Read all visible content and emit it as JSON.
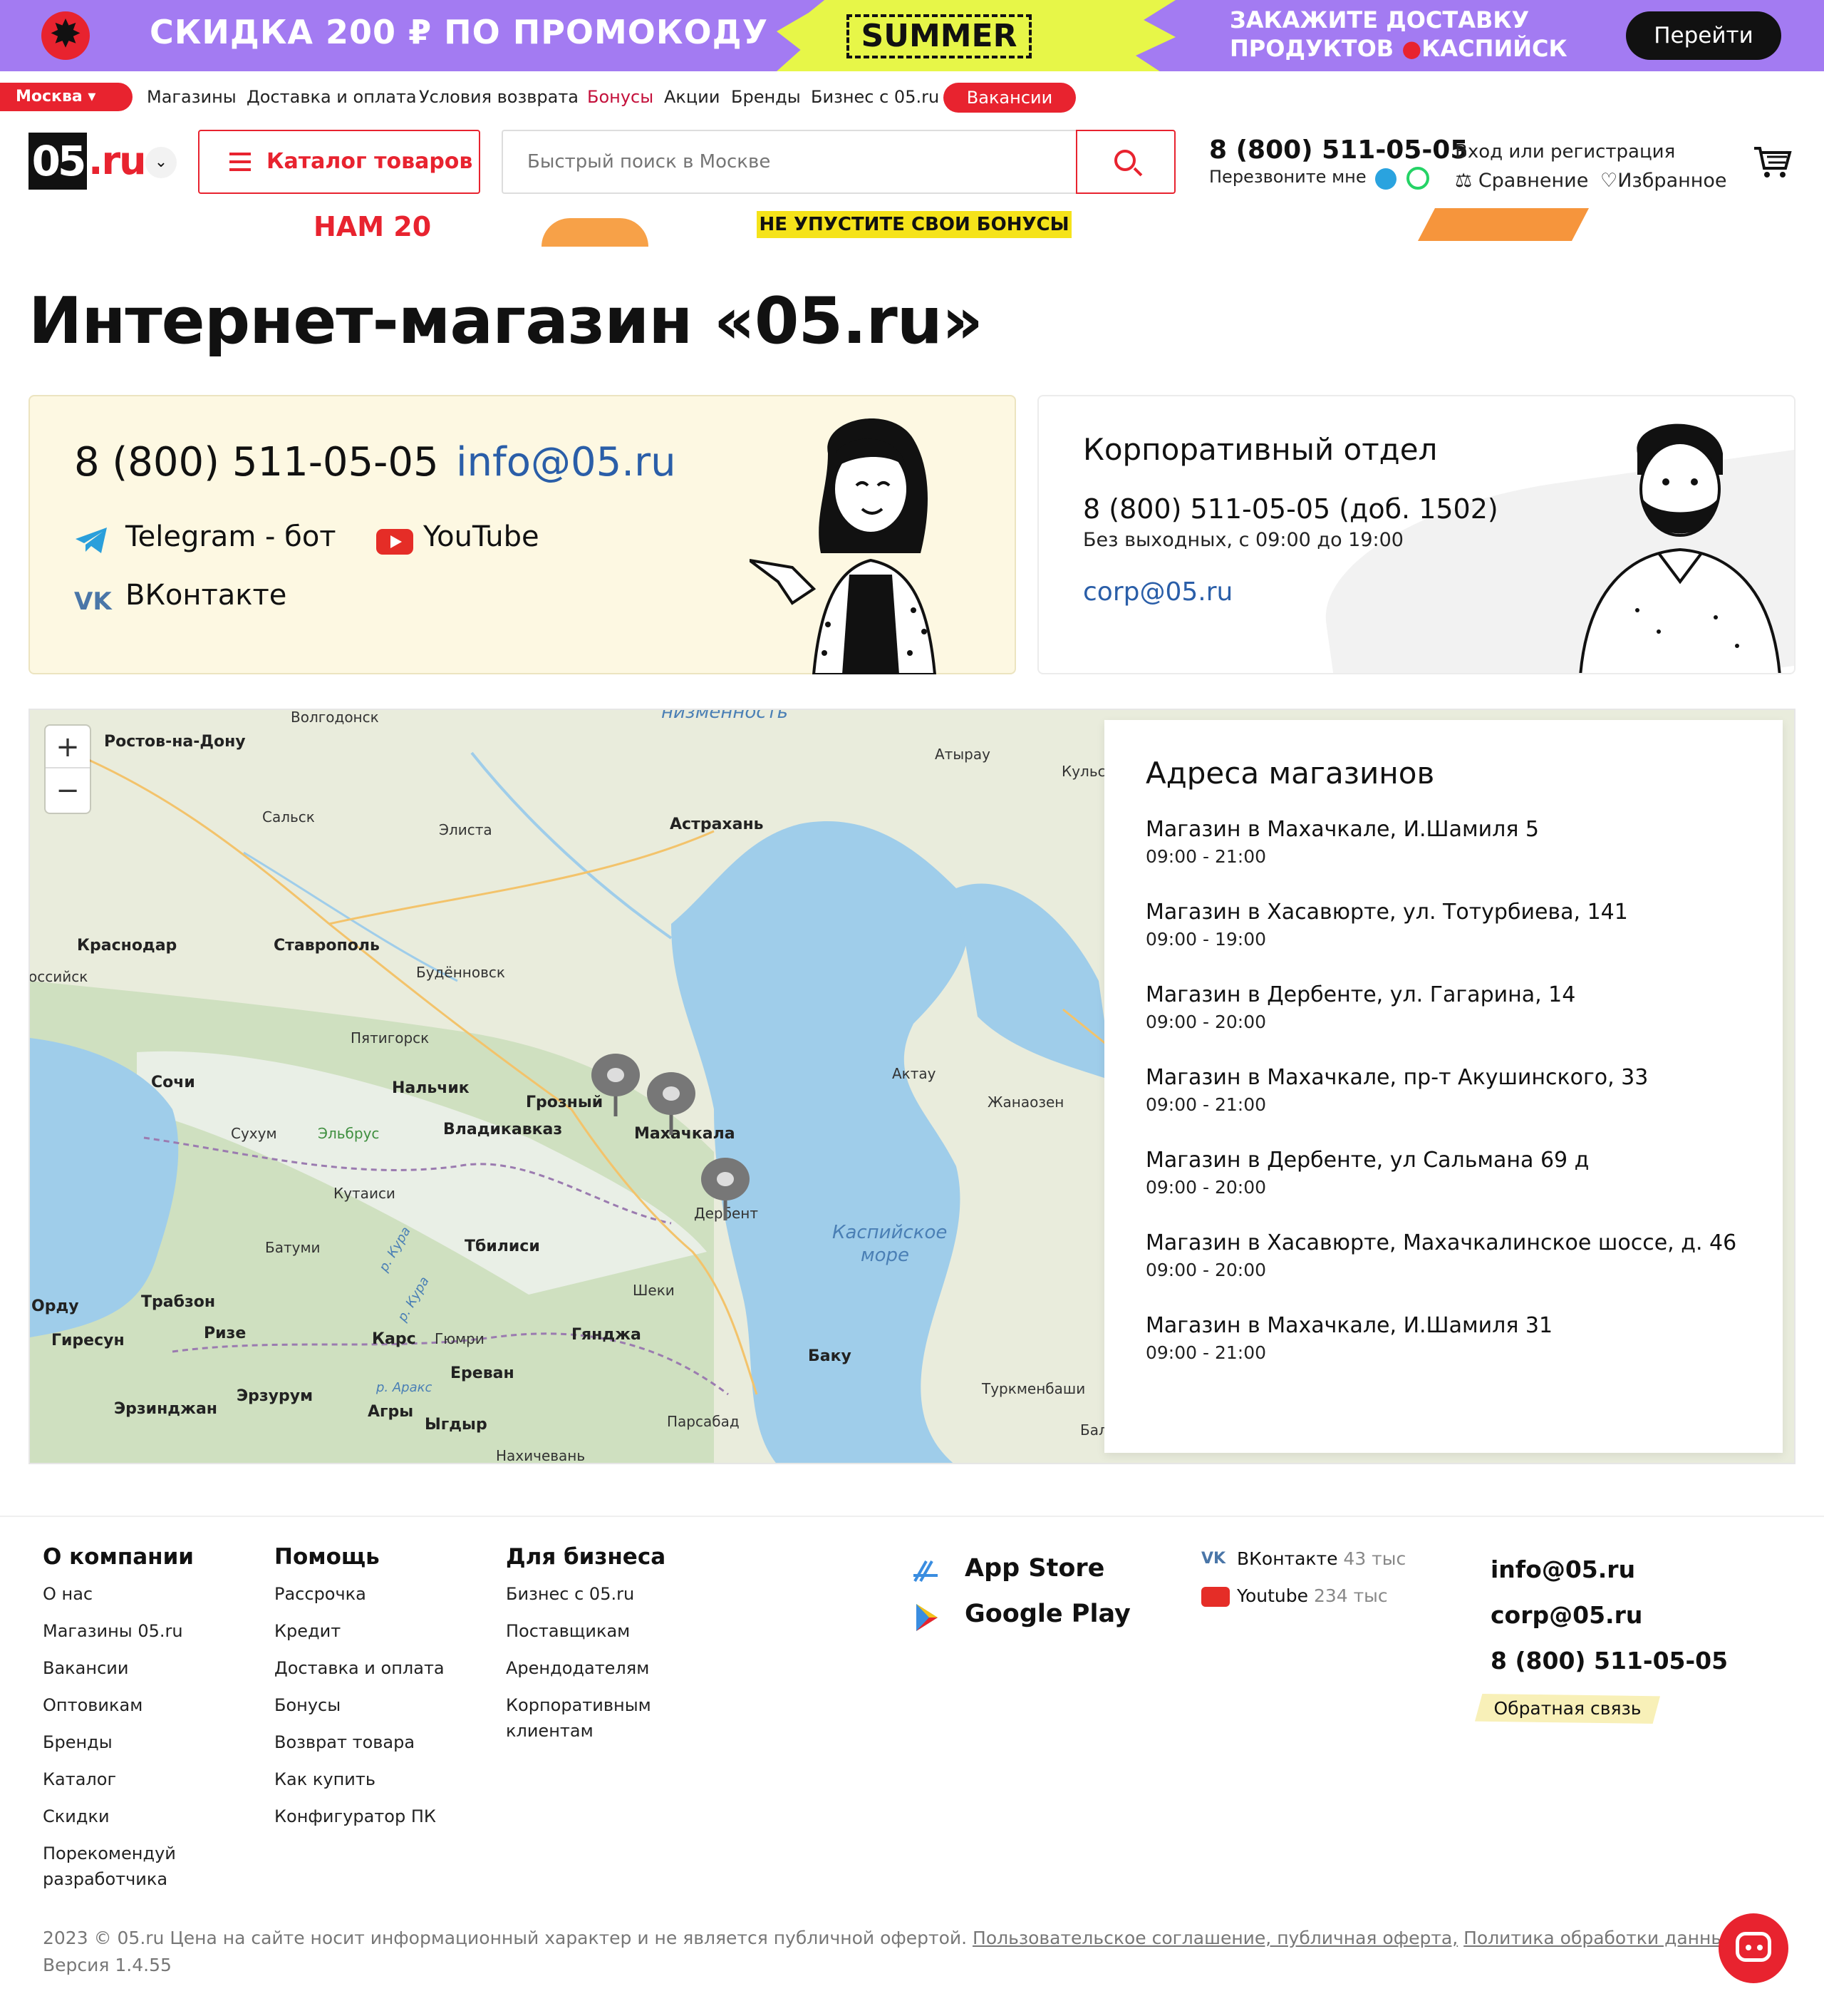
{
  "promo": {
    "headline": "СКИДКА 200 ₽  ПО ПРОМОКОДУ",
    "code": "SUMMER",
    "right_line1": "ЗАКАЖИТЕ ДОСТАВКУ",
    "right_line2_a": "ПРОДУКТОВ",
    "right_line2_b": "КАСПИЙСК",
    "button": "Перейти"
  },
  "toplinks": {
    "city": "Москва",
    "items": [
      "Магазины",
      "Доставка и оплата",
      "Условия возврата",
      "Бонусы",
      "Акции",
      "Бренды",
      "Бизнес с 05.ru"
    ],
    "vacancies": "Вакансии"
  },
  "header": {
    "logo_zero": "05",
    "logo_ru": ".ru",
    "catalog": "Каталог товаров",
    "search_placeholder": "Быстрый поиск в Москве",
    "phone": "8 (800) 511-05-05",
    "callback": "Перезвоните мне",
    "login": "Вход или регистрация",
    "compare": "Сравнение",
    "favorites": "Избранное"
  },
  "subbanner": {
    "nam": "НАМ 20",
    "bonus": "НЕ УПУСТИТЕ СВОИ БОНУСЫ"
  },
  "page_title": "Интернет-магазин «05.ru»",
  "contacts": {
    "phone": "8 (800) 511-05-05",
    "email": "info@05.ru",
    "telegram": "Telegram - бот",
    "youtube": "YouTube",
    "vk": "ВКонтакте"
  },
  "corporate": {
    "title": "Корпоративный отдел",
    "phone": "8 (800) 511-05-05 (доб. 1502)",
    "hours": "Без выходных, с 09:00 до 19:00",
    "email": "corp@05.ru"
  },
  "map": {
    "zoom_in": "+",
    "zoom_out": "−",
    "labels": {
      "volgodonsk": "Волгодонск",
      "rostov": "Ростов-на-Дону",
      "nizmennost": "низменность",
      "atyrau": "Атырау",
      "kulsary": "Кульса",
      "salsk": "Сальск",
      "elista": "Элиста",
      "astrakhan": "Астрахань",
      "krasnodar": "Краснодар",
      "stavropol": "Ставрополь",
      "rossiyskaya": "оссийск",
      "budennovsk": "Будённовск",
      "pyatigorsk": "Пятигорск",
      "sochi": "Сочи",
      "nalchik": "Нальчик",
      "grozny": "Грозный",
      "makhachkala": "Махачкала",
      "aktau": "Актау",
      "zhanaozen": "Жанаозен",
      "sukhum": "Сухум",
      "elbrus": "Эльбрус",
      "vladikavkaz": "Владикавказ",
      "derbent": "Дербент",
      "kutaisi": "Кутаиси",
      "batumi": "Батуми",
      "kura1": "р. Кура",
      "tbilisi": "Тбилиси",
      "sea1": "Каспийское",
      "sea2": "море",
      "ordu": "Орду",
      "trabzon": "Трабзон",
      "kura2": "р. Кура",
      "sheki": "Шеки",
      "giresun": "Гиресун",
      "rize": "Ризе",
      "kars": "Карс",
      "gyumri": "Гюмри",
      "ganja": "Гянджа",
      "baku": "Баку",
      "yerevan": "Ереван",
      "araks": "р. Аракс",
      "erzurum": "Эрзурум",
      "erzincan": "Эрзинджан",
      "agri": "Агры",
      "igdir": "Ыгдыр",
      "parsabad": "Парсабад",
      "turkmenbashi": "Туркменбаши",
      "bal": "Балк",
      "nakhchivan": "Нахичевань"
    }
  },
  "stores": {
    "title": "Адреса магазинов",
    "list": [
      {
        "name": "Магазин в Махачкале, И.Шамиля 5",
        "hours": "09:00 - 21:00"
      },
      {
        "name": "Магазин в Хасавюрте, ул. Тотурбиева, 141",
        "hours": "09:00 - 19:00"
      },
      {
        "name": "Магазин в Дербенте, ул. Гагарина, 14",
        "hours": "09:00 - 20:00"
      },
      {
        "name": "Магазин в Махачкале, пр-т Акушинского, 33",
        "hours": "09:00 - 21:00"
      },
      {
        "name": "Магазин в Дербенте, ул Сальмана 69 д",
        "hours": "09:00 - 20:00"
      },
      {
        "name": "Магазин в Хасавюрте, Махачкалинское шоссе, д. 46",
        "hours": "09:00 - 20:00"
      },
      {
        "name": "Магазин в Махачкале, И.Шамиля 31",
        "hours": "09:00 - 21:00"
      }
    ]
  },
  "footer": {
    "col1": {
      "title": "О компании",
      "links": [
        "О нас",
        "Магазины 05.ru",
        "Вакансии",
        "Оптовикам",
        "Бренды",
        "Каталог",
        "Скидки",
        "Порекомендуй разработчика"
      ]
    },
    "col2": {
      "title": "Помощь",
      "links": [
        "Рассрочка",
        "Кредит",
        "Доставка и оплата",
        "Бонусы",
        "Возврат товара",
        "Как купить",
        "Конфигуратор ПК"
      ]
    },
    "col3": {
      "title": "Для бизнеса",
      "links": [
        "Бизнес с 05.ru",
        "Поставщикам",
        "Арендодателям",
        "Корпоративным клиентам"
      ]
    },
    "apps": [
      "App Store",
      "Google Play"
    ],
    "social": [
      {
        "name": "ВКонтакте",
        "count": "43 тыс"
      },
      {
        "name": "Youtube",
        "count": "234 тыс"
      }
    ],
    "email": "info@05.ru",
    "corp_email": "corp@05.ru",
    "phone": "8 (800) 511-05-05",
    "feedback": "Обратная связь",
    "copyright": "2023 © 05.ru Цена на сайте носит информационный характер и не является публичной офертой.",
    "agreement": "Пользовательское соглашение, публичная оферта,",
    "privacy": "Политика обработки данных.",
    "version": "Версия 1.4.55"
  },
  "colors": {
    "brand_red": "#e8232f",
    "promo_purple": "#a37bf2",
    "link_blue": "#2a5ea8"
  }
}
